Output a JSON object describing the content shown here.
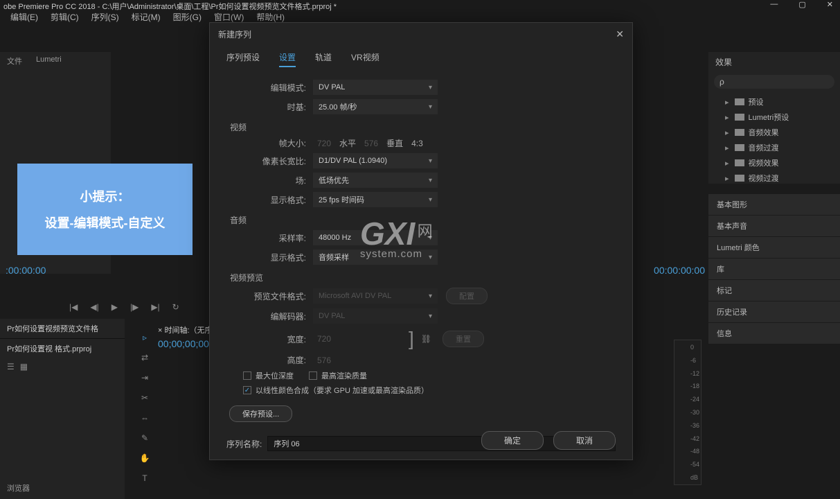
{
  "app": {
    "title": "obe Premiere Pro CC 2018 - C:\\用户\\Administrator\\桌面\\工程\\Pr如何设置视频预览文件格式.prproj *"
  },
  "menu": [
    "编辑(E)",
    "剪辑(C)",
    "序列(S)",
    "标记(M)",
    "图形(G)",
    "窗口(W)",
    "帮助(H)"
  ],
  "left_tabs": [
    "文件",
    "Lumetri"
  ],
  "preview_tip": {
    "line1": "小提示：",
    "line2": "设置-编辑模式-自定义"
  },
  "timecode_left": ":00:00:00",
  "timecode_right": "00:00:00:00",
  "project": {
    "tab": "Pr如何设置视频预览文件格",
    "item": "Pr如何设置视 格式.prproj"
  },
  "sequence": {
    "tab": "× 时间轴:（无序",
    "time": "00;00;00;00"
  },
  "effects": {
    "title": "效果",
    "search_placeholder": "ρ",
    "items": [
      "预设",
      "Lumetri预设",
      "音频效果",
      "音频过渡",
      "视频效果",
      "视频过渡"
    ]
  },
  "right_panels": [
    "基本图形",
    "基本声音",
    "Lumetri 颜色",
    "库",
    "标记",
    "历史记录",
    "信息"
  ],
  "audio_meter": [
    "0",
    "-6",
    "-12",
    "-18",
    "-24",
    "-30",
    "-36",
    "-42",
    "-48",
    "-54",
    "dB"
  ],
  "dialog": {
    "title": "新建序列",
    "tabs": [
      "序列预设",
      "设置",
      "轨道",
      "VR视频"
    ],
    "active_tab": 1,
    "edit_mode": {
      "label": "编辑模式:",
      "value": "DV PAL"
    },
    "timebase": {
      "label": "时基:",
      "value": "25.00 帧/秒"
    },
    "video_section": "视频",
    "frame_size": {
      "label": "帧大小:",
      "w": "720",
      "hlabel": "水平",
      "h": "576",
      "vlabel": "垂直",
      "ratio": "4:3"
    },
    "par": {
      "label": "像素长宽比:",
      "value": "D1/DV PAL (1.0940)"
    },
    "fields": {
      "label": "场:",
      "value": "低场优先"
    },
    "disp_fmt": {
      "label": "显示格式:",
      "value": "25 fps 时间码"
    },
    "audio_section": "音频",
    "sample_rate": {
      "label": "采样率:",
      "value": "48000 Hz"
    },
    "audio_disp": {
      "label": "显示格式:",
      "value": "音频采样"
    },
    "preview_section": "视频预览",
    "preview_fmt": {
      "label": "预览文件格式:",
      "value": "Microsoft AVI DV PAL"
    },
    "codec": {
      "label": "编解码器:",
      "value": "DV PAL"
    },
    "config_btn": "配置",
    "width": {
      "label": "宽度:",
      "value": "720"
    },
    "height": {
      "label": "高度:",
      "value": "576"
    },
    "reset_btn": "重置",
    "cb_max_depth": "最大位深度",
    "cb_max_quality": "最高渲染质量",
    "cb_linear": "以线性颜色合成（要求 GPU 加速或最高渲染品质）",
    "save_preset": "保存预设...",
    "seq_name_label": "序列名称:",
    "seq_name": "序列 06",
    "ok": "确定",
    "cancel": "取消"
  },
  "watermark": {
    "big": "GXI",
    "net": "网",
    "sub": "system.com"
  }
}
